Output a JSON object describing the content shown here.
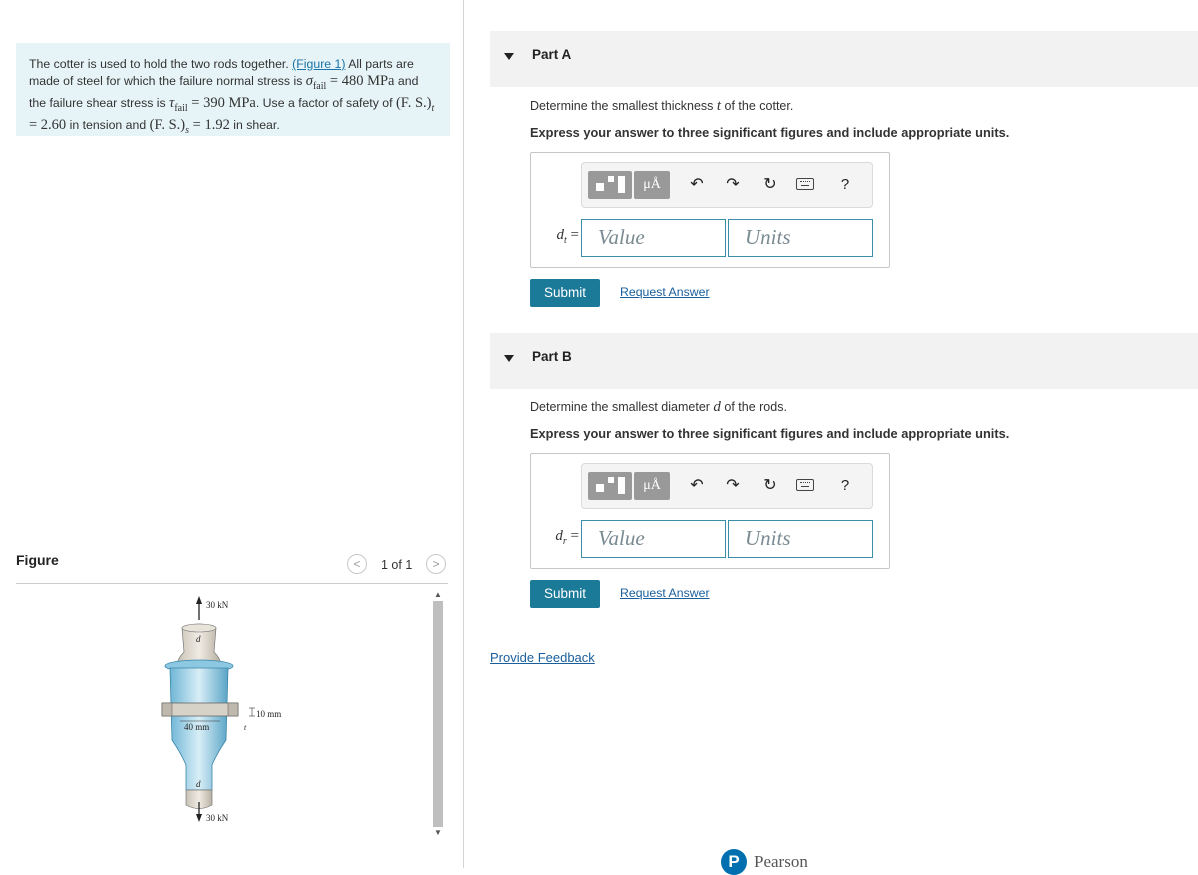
{
  "intro": {
    "t1": "The cotter is used to hold the two rods together. ",
    "figure_link": "(Figure 1)",
    "t2": " All parts are made of steel for which the failure normal stress is ",
    "sigma_expr": "σ",
    "fail_sub": "fail",
    "sigma_val": " = 480 MPa",
    "t3": " and the failure shear stress is ",
    "tau_expr": "τ",
    "tau_val": " = 390 MPa",
    "t4": ". Use a factor of safety of ",
    "fs_t": "(F. S.)",
    "fs_t_sub": "t",
    "fs_t_val": " = 2.60",
    "t5": " in tension and ",
    "fs_s": "(F. S.)",
    "fs_s_sub": "s",
    "fs_s_val": " = 1.92",
    "t6": " in shear."
  },
  "figure_panel": {
    "label": "Figure",
    "page_indicator": "1 of 1",
    "prev_icon": "<",
    "next_icon": ">",
    "labels": {
      "top_force": "30 kN",
      "bottom_force": "30 kN",
      "d_top": "d",
      "d_bottom": "d",
      "width": "40 mm",
      "thickness": "10 mm",
      "t": "t"
    }
  },
  "parts": [
    {
      "title": "Part A",
      "question_pre": "Determine the smallest thickness ",
      "question_var": "t",
      "question_post": " of the cotter.",
      "instruction": "Express your answer to three significant figures and include appropriate units.",
      "answer_var": "d",
      "answer_sub": "t",
      "answer_eq": " =",
      "value_placeholder": "Value",
      "units_placeholder": "Units",
      "submit": "Submit",
      "request_answer": "Request Answer"
    },
    {
      "title": "Part B",
      "question_pre": "Determine the smallest diameter ",
      "question_var": "d",
      "question_post": " of the rods.",
      "instruction": "Express your answer to three significant figures and include appropriate units.",
      "answer_var": "d",
      "answer_sub": "r",
      "answer_eq": " =",
      "value_placeholder": "Value",
      "units_placeholder": "Units",
      "submit": "Submit",
      "request_answer": "Request Answer"
    }
  ],
  "toolbar": {
    "units_symbol": "μÅ",
    "undo_icon": "↶",
    "redo_icon": "↷",
    "reset_icon": "↻",
    "help": "?"
  },
  "feedback": "Provide Feedback",
  "footer": {
    "logo_letter": "P",
    "brand": "Pearson"
  },
  "colors": {
    "accent": "#1c7a99",
    "link": "#1a5f9c",
    "intro_bg": "#e7f4f7"
  }
}
